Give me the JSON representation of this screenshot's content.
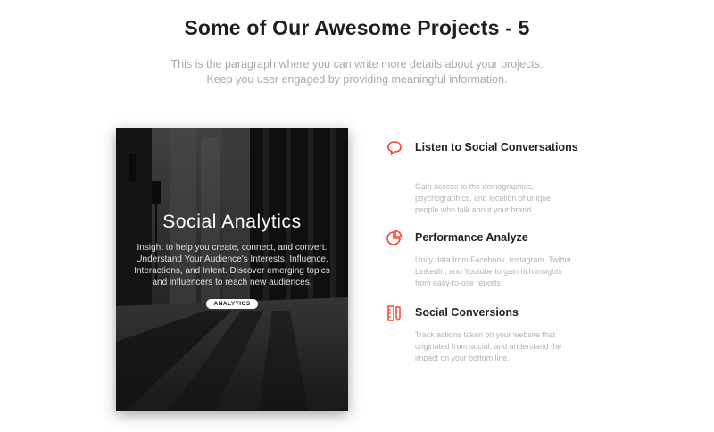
{
  "header": {
    "title": "Some of Our Awesome Projects - 5",
    "subtitle": "This is the paragraph where you can write more details about your projects. Keep you user engaged by providing meaningful information."
  },
  "card": {
    "title": "Social Analytics",
    "description": "Insight to help you create, connect, and convert. Understand Your Audience's Interests, Influence, Interactions, and Intent. Discover emerging topics and influencers to reach new audiences.",
    "tag": "ANALYTICS"
  },
  "features": [
    {
      "icon": "speech-bubble-icon",
      "title": "Listen to Social Conversations",
      "description": "Gain access to the demographics, psychographics, and location of unique people who talk about your brand."
    },
    {
      "icon": "pie-chart-icon",
      "title": "Performance Analyze",
      "description": "Unify data from Facebook, Instagram, Twitter, LinkedIn, and Youtube to gain rich insights from easy-to-use reports."
    },
    {
      "icon": "ruler-pencil-icon",
      "title": "Social Conversions",
      "description": "Track actions taken on your website that originated from social, and understand the impact on your bottom line."
    }
  ],
  "colors": {
    "accent": "#f44336",
    "title": "#1e1e1e",
    "muted": "#a9a9a9"
  }
}
